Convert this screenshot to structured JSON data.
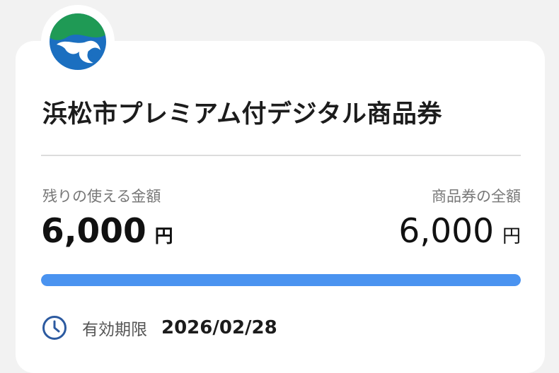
{
  "voucher": {
    "logo_icon": "hamamatsu-city-emblem-icon",
    "title": "浜松市プレミアム付デジタル商品券",
    "remaining_label": "残りの使える金額",
    "remaining_amount": "6,000",
    "remaining_unit": "円",
    "total_label": "商品券の全額",
    "total_amount": "6,000",
    "total_unit": "円",
    "remaining_fraction": 1.0,
    "expiry_icon": "clock-icon",
    "expiry_label": "有効期限",
    "expiry_date": "2026/02/28"
  },
  "colors": {
    "progress": "#4a93f0",
    "logo_green": "#1f9a55",
    "logo_blue": "#1b6fc0",
    "clock": "#2c5aa0"
  }
}
